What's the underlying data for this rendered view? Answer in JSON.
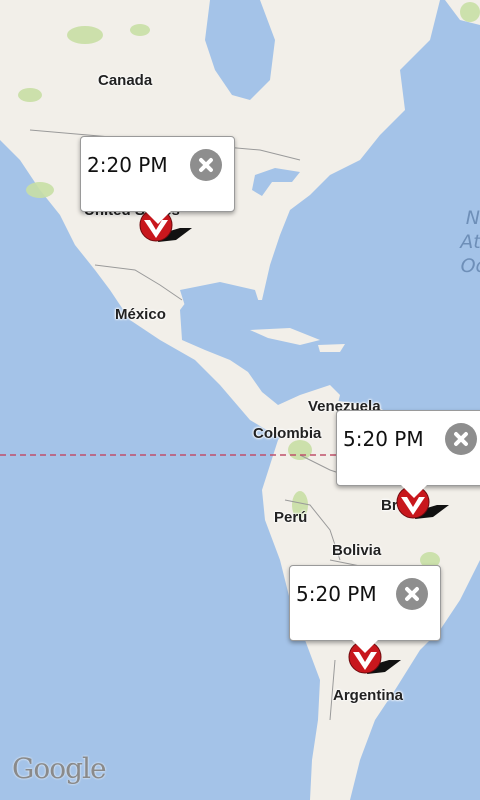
{
  "map": {
    "labels": {
      "canada": "Canada",
      "mexico": "México",
      "venezuela": "Venezuela",
      "colombia": "Colombia",
      "peru": "Perú",
      "bolivia": "Bolivia",
      "argentina": "Argentina",
      "ocean_line1": "N",
      "ocean_line2": "Atl",
      "ocean_line3": "Oc"
    },
    "attribution": "Google"
  },
  "popups": [
    {
      "time": "2:20 PM",
      "marker_label": "United States"
    },
    {
      "time": "5:20 PM",
      "marker_label": "Brasil"
    },
    {
      "time": "5:20 PM",
      "marker_label": ""
    }
  ],
  "colors": {
    "ocean": "#a4c3e8",
    "land": "#f2efe9",
    "vegetation": "#c8dfa5",
    "marker": "#c8171d",
    "equator_line": "#c0506a"
  },
  "icons": [
    "close-icon",
    "map-pin-icon"
  ]
}
